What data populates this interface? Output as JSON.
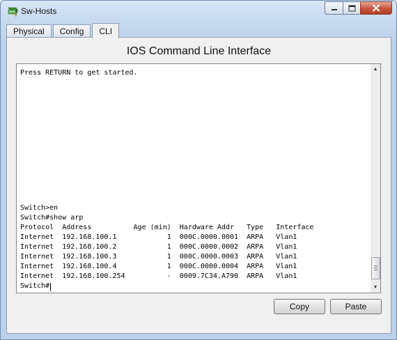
{
  "window": {
    "title": "Sw-Hosts"
  },
  "tabs": [
    {
      "label": "Physical",
      "active": false
    },
    {
      "label": "Config",
      "active": false
    },
    {
      "label": "CLI",
      "active": true
    }
  ],
  "cli": {
    "heading": "IOS Command Line Interface",
    "intro_line": "Press RETURN to get started.",
    "lines": [
      "Switch>en",
      "Switch#show arp",
      "Protocol  Address          Age (min)  Hardware Addr   Type   Interface",
      "Internet  192.168.100.1            1  000C.0000.0001  ARPA   Vlan1",
      "Internet  192.168.100.2            1  000C.0000.0002  ARPA   Vlan1",
      "Internet  192.168.100.3            1  000C.0000.0003  ARPA   Vlan1",
      "Internet  192.168.100.4            1  000C.0000.0004  ARPA   Vlan1",
      "Internet  192.168.100.254          -  0009.7C34.A790  ARPA   Vlan1",
      "Switch#"
    ]
  },
  "buttons": {
    "copy": "Copy",
    "paste": "Paste"
  },
  "icons": {
    "app": "packet-tracer-switch-icon",
    "minimize": "minimize-icon",
    "maximize": "maximize-icon",
    "close": "close-icon"
  }
}
